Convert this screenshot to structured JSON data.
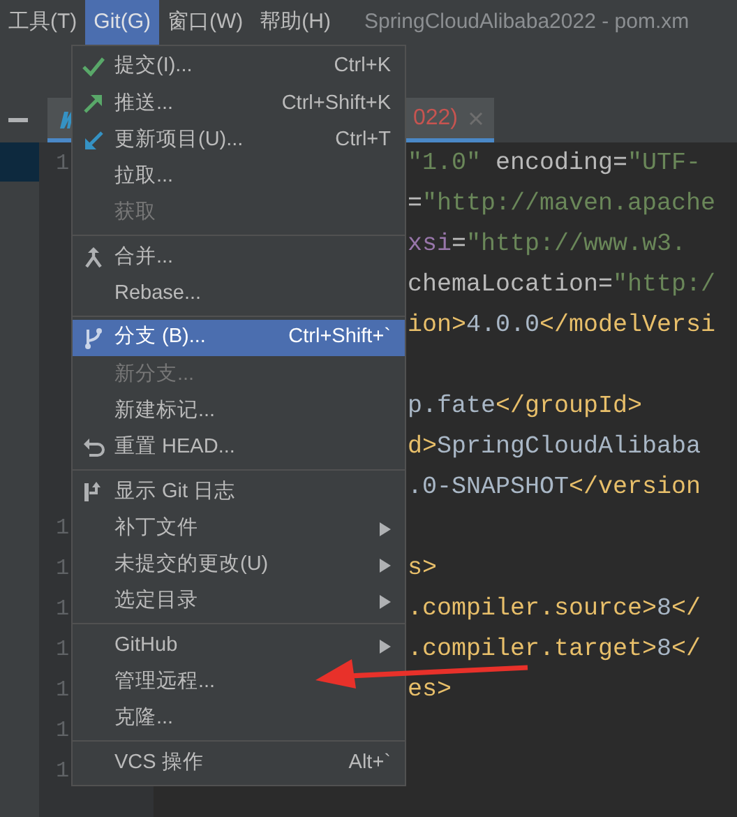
{
  "menubar": [
    {
      "label": "工具(T)",
      "selected": false
    },
    {
      "label": "Git(G)",
      "selected": true
    },
    {
      "label": "窗口(W)",
      "selected": false
    },
    {
      "label": "帮助(H)",
      "selected": false
    }
  ],
  "window": {
    "title": "SpringCloudAlibaba2022 - pom.xm"
  },
  "editor_tab": {
    "label": "022)"
  },
  "editor": {
    "lines": [
      {
        "kind": "code",
        "number": "1",
        "segments": [
          {
            "kind": "string",
            "text": "\"1.0\""
          },
          {
            "kind": "attr",
            "text": " encoding="
          },
          {
            "kind": "string",
            "text": "\"UTF-"
          }
        ]
      },
      {
        "kind": "code",
        "segments": [
          {
            "kind": "attr",
            "text": "="
          },
          {
            "kind": "string",
            "text": "\"http://maven.apache"
          }
        ]
      },
      {
        "kind": "code",
        "segments": [
          {
            "kind": "ns",
            "text": "xsi"
          },
          {
            "kind": "attr",
            "text": "="
          },
          {
            "kind": "string",
            "text": "\"http://www.w3."
          }
        ]
      },
      {
        "kind": "code",
        "segments": [
          {
            "kind": "attr",
            "text": "chemaLocation="
          },
          {
            "kind": "string",
            "text": "\"http:/"
          }
        ]
      },
      {
        "kind": "code",
        "segments": [
          {
            "kind": "tag",
            "text": "ion>"
          },
          {
            "kind": "text",
            "text": "4.0.0"
          },
          {
            "kind": "tag",
            "text": "</modelVersi"
          }
        ]
      },
      {
        "kind": "blank"
      },
      {
        "kind": "code",
        "segments": [
          {
            "kind": "text",
            "text": "p.fate"
          },
          {
            "kind": "tag",
            "text": "</groupId>"
          }
        ]
      },
      {
        "kind": "code",
        "segments": [
          {
            "kind": "tag",
            "text": "d>"
          },
          {
            "kind": "text",
            "text": "SpringCloudAlibaba"
          }
        ]
      },
      {
        "kind": "code",
        "segments": [
          {
            "kind": "text",
            "text": ".0-SNAPSHOT"
          },
          {
            "kind": "tag",
            "text": "</version"
          }
        ]
      },
      {
        "kind": "blank",
        "number": "1"
      },
      {
        "kind": "code",
        "number": "1",
        "segments": [
          {
            "kind": "tag",
            "text": "s>"
          }
        ]
      },
      {
        "kind": "code",
        "number": "1",
        "segments": [
          {
            "kind": "tag",
            "text": ".compiler.source>"
          },
          {
            "kind": "text",
            "text": "8"
          },
          {
            "kind": "tag",
            "text": "</"
          }
        ]
      },
      {
        "kind": "code",
        "number": "1",
        "segments": [
          {
            "kind": "tag",
            "text": ".compiler.target>"
          },
          {
            "kind": "text",
            "text": "8"
          },
          {
            "kind": "tag",
            "text": "</"
          }
        ]
      },
      {
        "kind": "code",
        "number": "1",
        "segments": [
          {
            "kind": "tag",
            "text": "es>"
          }
        ]
      },
      {
        "kind": "blank",
        "number": "1"
      },
      {
        "kind": "blank",
        "number": "1"
      }
    ]
  },
  "git_menu": {
    "groups": [
      [
        {
          "label": "提交(I)...",
          "shortcut": "Ctrl+K",
          "kind": "commit",
          "disabled": false,
          "selected": false,
          "submenu": false
        },
        {
          "label": "推送...",
          "shortcut": "Ctrl+Shift+K",
          "kind": "push",
          "disabled": false,
          "selected": false,
          "submenu": false
        },
        {
          "label": "更新项目(U)...",
          "shortcut": "Ctrl+T",
          "kind": "update",
          "disabled": false,
          "selected": false,
          "submenu": false
        },
        {
          "label": "拉取...",
          "disabled": false,
          "selected": false,
          "submenu": false
        },
        {
          "label": "获取",
          "disabled": true,
          "selected": false,
          "submenu": false
        }
      ],
      [
        {
          "label": "合并...",
          "kind": "merge",
          "disabled": false,
          "selected": false,
          "submenu": false
        },
        {
          "label": "Rebase...",
          "disabled": false,
          "selected": false,
          "submenu": false
        }
      ],
      [
        {
          "label": "分支 (B)...",
          "shortcut": "Ctrl+Shift+`",
          "kind": "branch",
          "disabled": false,
          "selected": true,
          "submenu": false
        },
        {
          "label": "新分支...",
          "disabled": true,
          "selected": false,
          "submenu": false
        },
        {
          "label": "新建标记...",
          "disabled": false,
          "selected": false,
          "submenu": false
        },
        {
          "label": "重置 HEAD...",
          "kind": "reset",
          "disabled": false,
          "selected": false,
          "submenu": false
        }
      ],
      [
        {
          "label": "显示 Git 日志",
          "kind": "log",
          "disabled": false,
          "selected": false,
          "submenu": false
        },
        {
          "label": "补丁文件",
          "disabled": false,
          "selected": false,
          "submenu": true
        },
        {
          "label": "未提交的更改(U)",
          "disabled": false,
          "selected": false,
          "submenu": true
        },
        {
          "label": "选定目录",
          "disabled": false,
          "selected": false,
          "submenu": true
        }
      ],
      [
        {
          "label": "GitHub",
          "disabled": false,
          "selected": false,
          "submenu": true
        },
        {
          "label": "管理远程...",
          "disabled": false,
          "selected": false,
          "submenu": false
        },
        {
          "label": "克隆...",
          "disabled": false,
          "selected": false,
          "submenu": false
        }
      ],
      [
        {
          "label": "VCS 操作",
          "shortcut": "Alt+`",
          "disabled": false,
          "selected": false,
          "submenu": false
        }
      ]
    ]
  }
}
